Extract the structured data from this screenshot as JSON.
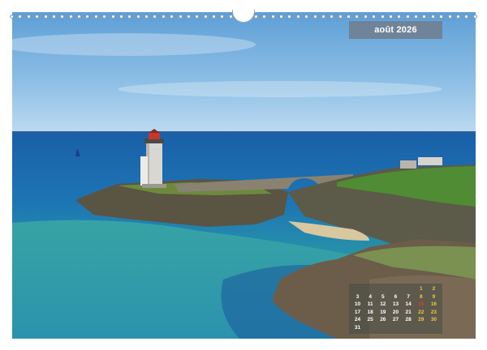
{
  "header": {
    "month_label": "août 2026"
  },
  "calendar": {
    "weeks": [
      [
        "",
        "",
        "",
        "",
        "",
        "1",
        "2"
      ],
      [
        "3",
        "4",
        "5",
        "6",
        "7",
        "8",
        "9"
      ],
      [
        "10",
        "11",
        "12",
        "13",
        "14",
        "15",
        "16"
      ],
      [
        "17",
        "18",
        "19",
        "20",
        "21",
        "22",
        "23"
      ],
      [
        "24",
        "25",
        "26",
        "27",
        "28",
        "29",
        "30"
      ],
      [
        "31",
        "",
        "",
        "",
        "",
        "",
        ""
      ]
    ],
    "holiday": "15",
    "weekday_color": "#ffffff",
    "weekend_color": "#f2c641",
    "holiday_color": "#e63b2e"
  },
  "colors": {
    "label_background": "#6f8499",
    "sky": "#7fb2dc",
    "sea": "#1f6fb0"
  }
}
